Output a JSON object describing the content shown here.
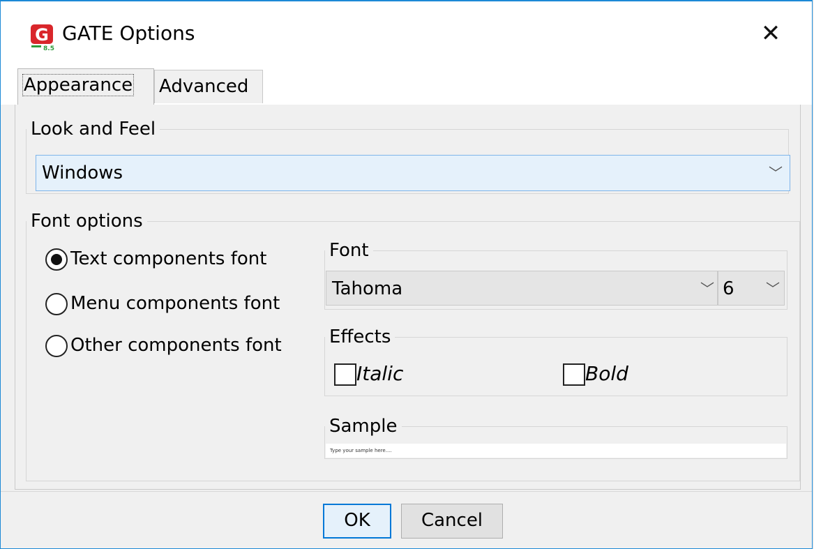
{
  "window": {
    "title": "GATE Options",
    "icon_letter": "G",
    "icon_caption": "8.5",
    "close_glyph": "✕"
  },
  "tabs": [
    {
      "label": "Appearance",
      "selected": true
    },
    {
      "label": "Advanced",
      "selected": false
    }
  ],
  "look_and_feel": {
    "legend": "Look and Feel",
    "selected": "Windows"
  },
  "font_options": {
    "legend": "Font options",
    "radios": [
      {
        "label": "Text components font",
        "checked": true
      },
      {
        "label": "Menu components font",
        "checked": false
      },
      {
        "label": "Other components font",
        "checked": false
      }
    ],
    "font": {
      "legend": "Font",
      "family": "Tahoma",
      "size": "6"
    },
    "effects": {
      "legend": "Effects",
      "italic_label": "Italic",
      "italic_checked": false,
      "bold_label": "Bold",
      "bold_checked": false
    },
    "sample": {
      "legend": "Sample",
      "text": "Type your sample here...."
    }
  },
  "buttons": {
    "ok": "OK",
    "cancel": "Cancel"
  },
  "colors": {
    "accent": "#0078d7",
    "combo_bg": "#e5f1fb",
    "icon_red": "#d9262b",
    "icon_green": "#2e9b3b"
  }
}
